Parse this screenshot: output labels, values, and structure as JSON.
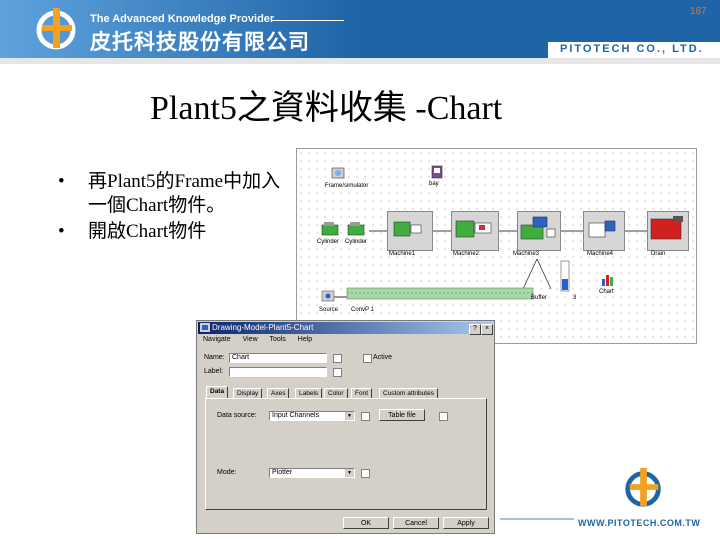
{
  "header": {
    "company_en": "The Advanced Knowledge Provider",
    "company_zh": "皮托科技股份有限公司",
    "brand": "PITOTECH CO., LTD.",
    "page_number": "187"
  },
  "slide": {
    "title": "Plant5之資料收集 -Chart",
    "bullets": [
      "再Plant5的Frame中加入一個Chart物件。",
      "開啟Chart物件"
    ]
  },
  "diagram": {
    "labels": {
      "frame1": "Frame/simulator",
      "bay": "bay",
      "src1": "Cylinder",
      "src2": "Cylinder",
      "m1": "Machine1",
      "m2": "Machine2",
      "m3": "Machine3",
      "m4": "Machine4",
      "drain": "Drain",
      "chart": "Chart",
      "source": "Source",
      "buffer": "Buffer",
      "conv": "ConvP 1",
      "ctrl": "3"
    }
  },
  "dialog": {
    "title": "Drawing-Model-Plant5-Chart",
    "menu": [
      "Navigate",
      "View",
      "Tools",
      "Help"
    ],
    "name_label": "Name:",
    "name_value": "Chart",
    "label_label": "Label:",
    "label_value": "",
    "active_label": "Active",
    "tabs": [
      "Data",
      "Display",
      "Axes",
      "Labels",
      "Color",
      "Font",
      "Custom attributes"
    ],
    "data_source_label": "Data source:",
    "data_source_value": "Input Channels",
    "table_file_button": "Table file",
    "mode_label": "Mode:",
    "mode_value": "Plotter",
    "ok": "OK",
    "cancel": "Cancel",
    "apply": "Apply",
    "help_icon": "?",
    "close_icon": "×"
  },
  "footer": {
    "website": "WWW.PITOTECH.COM.TW"
  },
  "colors": {
    "brand_blue": "#1f64a6",
    "accent_orange": "#e8701a",
    "machine_green": "#3fae3f",
    "drain_red": "#d21f1f"
  }
}
